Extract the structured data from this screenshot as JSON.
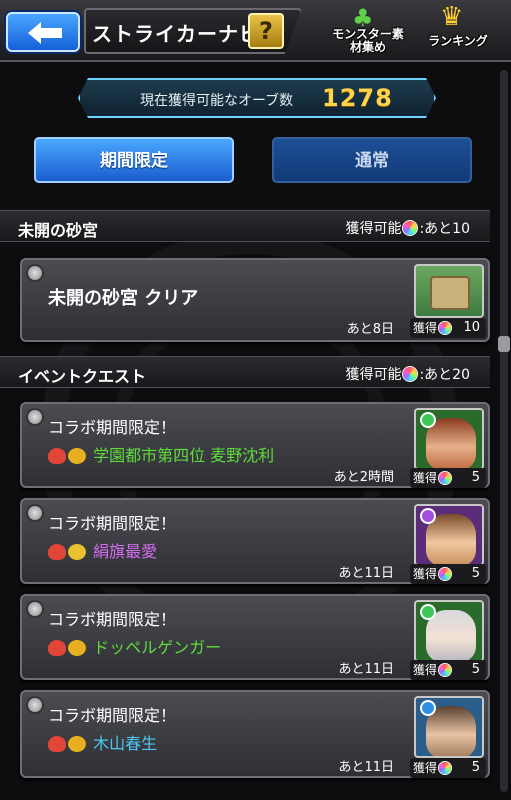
{
  "header": {
    "title": "ストライカーナビ",
    "help_label": "?",
    "monster_label": "モンスター素材集め",
    "ranking_label": "ランキング"
  },
  "orbs": {
    "label": "現在獲得可能なオーブ数",
    "count": "1278"
  },
  "tabs": [
    {
      "label": "期間限定",
      "active": true
    },
    {
      "label": "通常",
      "active": false
    }
  ],
  "sections": [
    {
      "title": "未開の砂宮",
      "reward_prefix": "獲得可能",
      "reward_suffix": ":あと10",
      "cards": [
        {
          "title": "未開の砂宮 クリア",
          "time": "あと8日",
          "reward_label": "獲得",
          "reward_count": "10"
        }
      ]
    },
    {
      "title": "イベントクエスト",
      "reward_prefix": "獲得可能",
      "reward_suffix": ":あと20",
      "cards": [
        {
          "title": "コラボ期間限定！",
          "subtitle": "学園都市第四位 麦野沈利",
          "subtitle_color": "#5fdc3c",
          "time": "あと2時間",
          "reward_label": "獲得",
          "reward_count": "5",
          "element_color": "#3cc85a"
        },
        {
          "title": "コラボ期間限定！",
          "subtitle": "絹旗最愛",
          "subtitle_color": "#d36cf0",
          "time": "あと11日",
          "reward_label": "獲得",
          "reward_count": "5",
          "element_color": "#a04de0"
        },
        {
          "title": "コラボ期間限定！",
          "subtitle": "ドッペルゲンガー",
          "subtitle_color": "#5fdc3c",
          "time": "あと11日",
          "reward_label": "獲得",
          "reward_count": "5",
          "element_color": "#3cc85a"
        },
        {
          "title": "コラボ期間限定！",
          "subtitle": "木山春生",
          "subtitle_color": "#4cc8f0",
          "time": "あと11日",
          "reward_label": "獲得",
          "reward_count": "5",
          "element_color": "#2e8ee0"
        }
      ]
    }
  ],
  "colors": {
    "accent_blue": "#1b5dcf",
    "orb_count": "#ffd34a"
  }
}
